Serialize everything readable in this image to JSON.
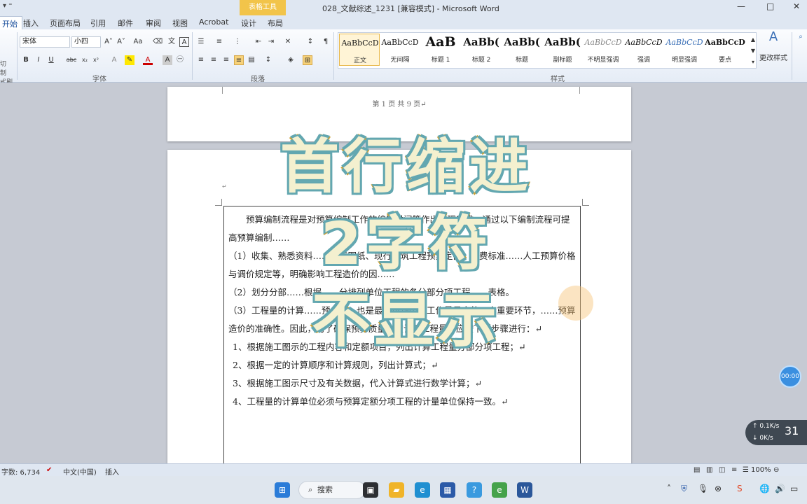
{
  "titlebar": {
    "quick_access": "▾ ⁼",
    "context_tab": "表格工具",
    "title": "028_文献综述_1231 [兼容模式] - Microsoft Word",
    "min": "—",
    "max": "□",
    "close": "✕"
  },
  "tabs": [
    "开始",
    "插入",
    "页面布局",
    "引用",
    "邮件",
    "审阅",
    "视图",
    "Acrobat",
    "设计",
    "布局"
  ],
  "ribbon": {
    "left_stub": [
      "切",
      "制",
      "式刷"
    ],
    "font_name": "宋体",
    "font_size": "小四",
    "group_font": "字体",
    "group_paragraph": "段落",
    "group_styles": "样式",
    "change_styles": "更改样式",
    "styles": [
      {
        "sample": "AaBbCcD",
        "name": "正文"
      },
      {
        "sample": "AaBbCcD",
        "name": "无间隔"
      },
      {
        "sample": "AaB",
        "name": "标题 1"
      },
      {
        "sample": "AaBb(",
        "name": "标题 2"
      },
      {
        "sample": "AaBb(",
        "name": "标题"
      },
      {
        "sample": "AaBb(",
        "name": "副标题"
      },
      {
        "sample": "AaBbCcD",
        "name": "不明显强调"
      },
      {
        "sample": "AaBbCcD",
        "name": "强调"
      },
      {
        "sample": "AaBbCcD",
        "name": "明显强调"
      },
      {
        "sample": "AaBbCcD",
        "name": "要点"
      }
    ]
  },
  "document": {
    "page1_footer": "第 1 页 共 9 页↵",
    "paragraphs": [
      {
        "text": "预算编制流程是对预算编制工作的编制时间等作出合理安排，通过以下编制流程可提高预算编制……",
        "style": "indent"
      },
      {
        "text": "（1）收集、熟悉资料……施工图纸、现行建筑工程预算定额、取费标准……人工预算价格与调价规定等，明确影响工程造价的因……",
        "style": "plain"
      },
      {
        "text": "（2）划分分部……根据……分排列单位工程的各分部分项工程……表格。",
        "style": "plain"
      },
      {
        "text": "（3）工程量的计算……预……，也是最不可缺少、工作量最大的一个重要环节，……预算造价的准确性。因此，为了确保预算质量，在计算工程量时应按下列步骤进行：↵",
        "style": "plain"
      },
      {
        "text": "1、根据施工图示的工程内容和定额项目，列出计算工程量分部分项工程；↵",
        "style": "list"
      },
      {
        "text": "2、根据一定的计算顺序和计算规则，列出计算式；↵",
        "style": "list"
      },
      {
        "text": "3、根据施工图示尺寸及有关数据，代入计算式进行数学计算；↵",
        "style": "list"
      },
      {
        "text": "4、工程量的计算单位必须与预算定额分项工程的计量单位保持一致。↵",
        "style": "list"
      }
    ]
  },
  "overlay": {
    "line1": "首行缩进",
    "line2": "2字符",
    "line3": "不显示"
  },
  "status": {
    "word_count": "字数: 6,734",
    "language": "中文(中国)",
    "mode": "插入",
    "zoom": "100%"
  },
  "taskbar": {
    "search": "搜索"
  },
  "widgets": {
    "timer": "00:00",
    "net_up": "↑ 0.1K/s",
    "net_down": "↓ 0K/s",
    "cpu": "31"
  }
}
